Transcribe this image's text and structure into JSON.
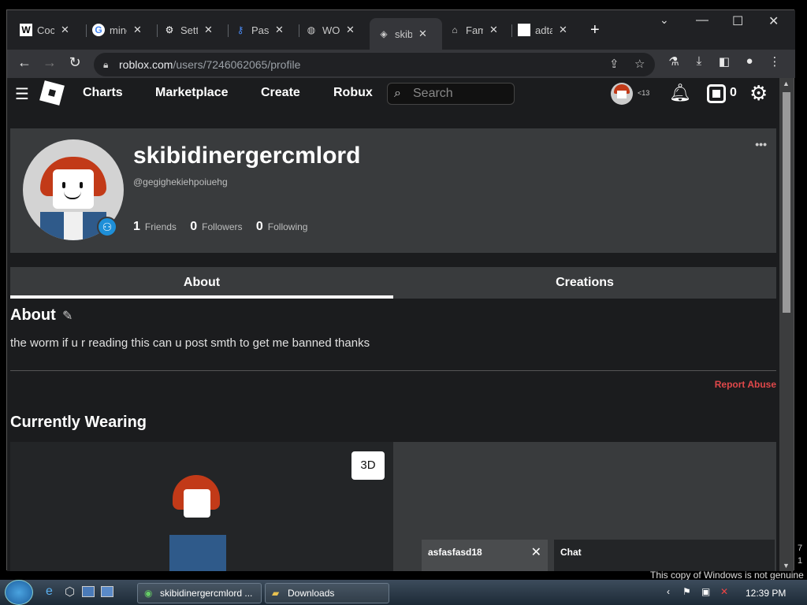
{
  "browser": {
    "tabs": [
      {
        "icon": "wikipedia-icon",
        "label": "Cocl"
      },
      {
        "icon": "google-icon",
        "label": "mine"
      },
      {
        "icon": "settings-icon",
        "label": "Setti"
      },
      {
        "icon": "key-icon",
        "label": "Pass"
      },
      {
        "icon": "globe-icon",
        "label": "WO!"
      },
      {
        "icon": "roblox-icon",
        "label": "skibi"
      },
      {
        "icon": "bank-icon",
        "label": "Fam"
      },
      {
        "icon": "blank-page-icon",
        "label": "adta"
      }
    ],
    "active_tab_index": 5,
    "url_host": "roblox.com",
    "url_path": "/users/7246062065/profile"
  },
  "roblox_nav": {
    "links": [
      "Charts",
      "Marketplace",
      "Create",
      "Robux"
    ],
    "search_placeholder": "Search",
    "friend_badge": "<13",
    "robux_count": "0"
  },
  "profile": {
    "display_name": "skibidinergercmlord",
    "username": "@gegighekiehpoiuehg",
    "friends": {
      "count": "1",
      "label": "Friends"
    },
    "followers": {
      "count": "0",
      "label": "Followers"
    },
    "following": {
      "count": "0",
      "label": "Following"
    },
    "more_label": "•••"
  },
  "tabs": {
    "about": "About",
    "creations": "Creations"
  },
  "about": {
    "heading": "About",
    "text": "the worm if u r reading this can u post smth to get me banned thanks",
    "report": "Report Abuse"
  },
  "wearing": {
    "heading": "Currently Wearing",
    "btn_3d": "3D"
  },
  "chat": {
    "friend_tab": "asfasfasd18",
    "chat_label": "Chat"
  },
  "taskbar": {
    "items": [
      "skibidinergercmlord ...",
      "Downloads"
    ],
    "time": "12:39 PM",
    "notice": "This copy of Windows is not genuine",
    "edge_text": "7\n1"
  },
  "colors": {
    "accent": "#e0484a",
    "page_bg": "#1b1c1e",
    "card_bg": "#393b3d"
  }
}
